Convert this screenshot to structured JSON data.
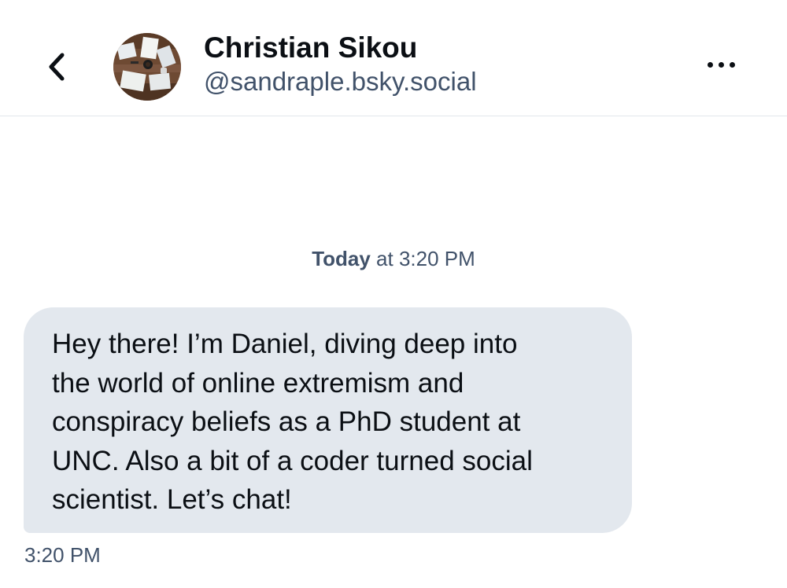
{
  "header": {
    "back_icon": "chevron-left-icon",
    "avatar_icon": "profile-photo-desk-flatlay",
    "display_name": "Christian Sikou",
    "handle": "@sandraple.bsky.social",
    "more_icon": "ellipsis-horizontal-icon"
  },
  "conversation": {
    "date_separator": {
      "day": "Today",
      "rest": " at 3:20 PM"
    },
    "messages": [
      {
        "text": "Hey there! I’m Daniel, diving deep into\nthe world of online extremism and\nconspiracy beliefs as a PhD student at\nUNC. Also a bit of a coder turned social\nscientist. Let’s chat!",
        "time": "3:20 PM"
      }
    ]
  },
  "colors": {
    "primary_text": "#0b0f14",
    "secondary_text": "#41526a",
    "bubble_background": "#e3e8ee",
    "divider": "#e2e6eb"
  }
}
